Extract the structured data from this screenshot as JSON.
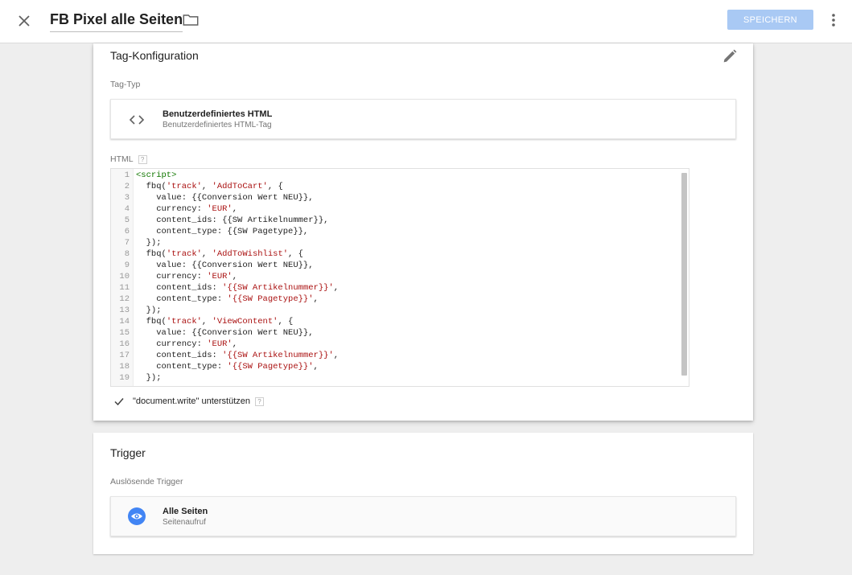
{
  "header": {
    "title": "FB Pixel alle Seiten",
    "save_label": "Speichern",
    "icons": [
      "close-icon",
      "folder-icon",
      "more-vert-icon"
    ]
  },
  "tag_config": {
    "card_title": "Tag-Konfiguration",
    "tag_type_label": "Tag-Typ",
    "tag_type": {
      "name": "Benutzerdefiniertes HTML",
      "description": "Benutzerdefiniertes HTML-Tag",
      "icon": "code-icon"
    },
    "html_label": "HTML",
    "help_mark": "?",
    "code_lines": [
      {
        "n": "1",
        "parts": [
          {
            "t": "<script>",
            "c": "tg"
          }
        ]
      },
      {
        "n": "2",
        "parts": [
          {
            "t": "  fbq(",
            "c": ""
          },
          {
            "t": "'track'",
            "c": "st"
          },
          {
            "t": ", ",
            "c": ""
          },
          {
            "t": "'AddToCart'",
            "c": "st"
          },
          {
            "t": ", {",
            "c": ""
          }
        ]
      },
      {
        "n": "3",
        "parts": [
          {
            "t": "    value: {{Conversion Wert NEU}},",
            "c": ""
          }
        ]
      },
      {
        "n": "4",
        "parts": [
          {
            "t": "    currency: ",
            "c": ""
          },
          {
            "t": "'EUR'",
            "c": "st"
          },
          {
            "t": ",",
            "c": ""
          }
        ]
      },
      {
        "n": "5",
        "parts": [
          {
            "t": "    content_ids: {{SW Artikelnummer}},",
            "c": ""
          }
        ]
      },
      {
        "n": "6",
        "parts": [
          {
            "t": "    content_type: {{SW Pagetype}},",
            "c": ""
          }
        ]
      },
      {
        "n": "7",
        "parts": [
          {
            "t": "  });",
            "c": ""
          }
        ]
      },
      {
        "n": "8",
        "parts": [
          {
            "t": "  fbq(",
            "c": ""
          },
          {
            "t": "'track'",
            "c": "st"
          },
          {
            "t": ", ",
            "c": ""
          },
          {
            "t": "'AddToWishlist'",
            "c": "st"
          },
          {
            "t": ", {",
            "c": ""
          }
        ]
      },
      {
        "n": "9",
        "parts": [
          {
            "t": "    value: {{Conversion Wert NEU}},",
            "c": ""
          }
        ]
      },
      {
        "n": "10",
        "parts": [
          {
            "t": "    currency: ",
            "c": ""
          },
          {
            "t": "'EUR'",
            "c": "st"
          },
          {
            "t": ",",
            "c": ""
          }
        ]
      },
      {
        "n": "11",
        "parts": [
          {
            "t": "    content_ids: ",
            "c": ""
          },
          {
            "t": "'{{SW Artikelnummer}}'",
            "c": "st"
          },
          {
            "t": ",",
            "c": ""
          }
        ]
      },
      {
        "n": "12",
        "parts": [
          {
            "t": "    content_type: ",
            "c": ""
          },
          {
            "t": "'{{SW Pagetype}}'",
            "c": "st"
          },
          {
            "t": ",",
            "c": ""
          }
        ]
      },
      {
        "n": "13",
        "parts": [
          {
            "t": "  });",
            "c": ""
          }
        ]
      },
      {
        "n": "14",
        "parts": [
          {
            "t": "  fbq(",
            "c": ""
          },
          {
            "t": "'track'",
            "c": "st"
          },
          {
            "t": ", ",
            "c": ""
          },
          {
            "t": "'ViewContent'",
            "c": "st"
          },
          {
            "t": ", {",
            "c": ""
          }
        ]
      },
      {
        "n": "15",
        "parts": [
          {
            "t": "    value: {{Conversion Wert NEU}},",
            "c": ""
          }
        ]
      },
      {
        "n": "16",
        "parts": [
          {
            "t": "    currency: ",
            "c": ""
          },
          {
            "t": "'EUR'",
            "c": "st"
          },
          {
            "t": ",",
            "c": ""
          }
        ]
      },
      {
        "n": "17",
        "parts": [
          {
            "t": "    content_ids: ",
            "c": ""
          },
          {
            "t": "'{{SW Artikelnummer}}'",
            "c": "st"
          },
          {
            "t": ",",
            "c": ""
          }
        ]
      },
      {
        "n": "18",
        "parts": [
          {
            "t": "    content_type: ",
            "c": ""
          },
          {
            "t": "'{{SW Pagetype}}'",
            "c": "st"
          },
          {
            "t": ",",
            "c": ""
          }
        ]
      },
      {
        "n": "19",
        "parts": [
          {
            "t": "  });",
            "c": ""
          }
        ]
      }
    ],
    "document_write_label": "\"document.write\" unterstützen",
    "document_write_checked": true
  },
  "trigger": {
    "card_title": "Trigger",
    "firing_label": "Auslösende Trigger",
    "item": {
      "name": "Alle Seiten",
      "type": "Seitenaufruf",
      "icon": "eye-icon"
    }
  },
  "colors": {
    "accent": "#4285f4",
    "save_button": "#a9c9f4",
    "code_tag": "#117700",
    "code_string": "#aa1111"
  }
}
